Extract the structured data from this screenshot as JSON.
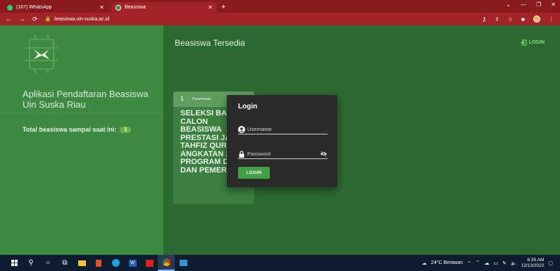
{
  "browser": {
    "tabs": [
      {
        "label": "(167) WhatsApp",
        "icon": "whatsapp-icon",
        "active": false
      },
      {
        "label": "Beasiswa",
        "icon": "site-favicon",
        "active": true
      }
    ],
    "url": "beasiswa.uin-suska.ac.id"
  },
  "sidebar": {
    "app_title": "Aplikasi Pendaftaran Beasiswa Uin Suska Riau",
    "total_label": "Total beasiswa sampai saat ini:",
    "total_count": "1"
  },
  "main": {
    "title": "Beasiswa Tersedia",
    "login_link": "LOGIN",
    "card": {
      "number": "1",
      "category": "Penerimaan",
      "title": "SELEKSI BAKAL CALON BEASISWA PRESTASI JALUR TAHFIZ QUR'AN ANGKATAN 2022 PROGRAM D3/D4 DAN PEMERINTAH"
    }
  },
  "modal": {
    "title": "Login",
    "username_placeholder": "Username",
    "password_placeholder": "Password",
    "button_label": "LOGIN"
  },
  "taskbar": {
    "weather": "24°C  Berawan",
    "time": "6:35 AM",
    "date": "12/13/2022"
  },
  "colors": {
    "chrome": "#a32427",
    "sidebar": "#3e8a43",
    "page_bg": "#2d6a31",
    "accent": "#43a047"
  }
}
